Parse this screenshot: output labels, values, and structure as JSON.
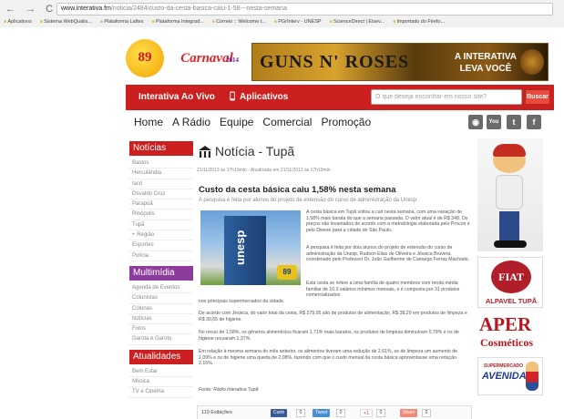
{
  "browser": {
    "nav_buttons": "← → C ⌂",
    "url_host": "www.interativa.fm",
    "url_path": "/noticia/2484/custo-da-cesta-basica-caiu-1-58---nesta-semana",
    "bookmarks": [
      "Aplicativos",
      "Sistema WebQualis...",
      "Plataforma Lattes",
      "Plataforma Integrad...",
      "Correio :: Welcome t...",
      "PGrInterv - UNESP",
      "ScienceDirect | Elsev...",
      "Importado do Firefo..."
    ]
  },
  "banner": {
    "logo_text": "89",
    "carnaval_text": "Carnaval",
    "carnaval_year": "2014",
    "ad_title": "GUNS N' ROSES",
    "ad_slogan_line1": "A INTERATIVA",
    "ad_slogan_line2": "LEVA VOCÊ"
  },
  "red_nav": {
    "live_label": "Interativa Ao Vivo",
    "apps_label": "Aplicativos",
    "search_placeholder": "O que deseja encontrar em nosso site?",
    "search_button": "Buscar"
  },
  "main_menu": [
    "Home",
    "A Rádio",
    "Equipe",
    "Comercial",
    "Promoção"
  ],
  "social_icons": [
    "rss-icon",
    "youtube-icon",
    "twitter-icon",
    "facebook-icon"
  ],
  "social_glyphs": [
    "◉",
    "You",
    "t",
    "f"
  ],
  "sidebar": {
    "noticias": {
      "title": "Notícias",
      "items": [
        "Bastos",
        "Herculândia",
        "Iacri",
        "Osvaldo Cruz",
        "Parapuã",
        "Rinópolis",
        "Tupã",
        "+ Região",
        "Esportes",
        "Polícia"
      ]
    },
    "multimidia": {
      "title": "Multimídia",
      "items": [
        "Agenda de Eventos",
        "Colunistas",
        "Colunas",
        "Notícias",
        "Fotos",
        "Garota e Garoto"
      ]
    },
    "atualidades": {
      "title": "Atualidades",
      "items": [
        "Bem Estar",
        "Música",
        "TV e Cinema"
      ]
    }
  },
  "article": {
    "section_title": "Notícia - Tupã",
    "dateline": "21/11/2013 às 17h19min - Atualizada em 21/11/2013 às 17h19min",
    "headline": "Custo da cesta básica caiu 1,58% nesta semana",
    "subhead": "A pesquisa é feita por alunos do projeto de extensão do curso de administração da Unesp",
    "photo_text": "unesp",
    "photo_badge": "89",
    "paragraphs": {
      "p1": "A cesta básica em Tupã voltou a cair nesta semana, com uma variação de 1,58% mais barata do que a semana passada. O valor atual é de R$ 348. Os preços são levantados de acordo com a metodologia elaborada pelo Procon e pelo Dieese para a cidade de São Paulo.",
      "p2": "A pesquisa é feita por dois alunos do projeto de extensão do curso de administração da Unesp, Rudson Elias de Oliveira e Jéssica Bruvera, coordenado pelo Professor Dr. João Guilherme de Camargo Ferraz Machado.",
      "p3a": "Esta cesta se refere a uma família de quatro membros com renda média familiar de 10,3 salários mínimos mensais, e é composta por 31 produtos comercializados",
      "p3b": "nos principais supermercados da cidade.",
      "p4": "De acordo com Jéssica, do valor total da cesta, R$ 279,05 são de produtos de alimentação, R$ 38,29 em produtos de limpeza e R$ 30,65 de higiene.",
      "p5": "No recuo de 1,58%, os gêneros alimentícios ficaram 1,71% mais baratos, os produtos de limpeza diminuíram 0,79% e os de higiene recuaram 1,37%.",
      "p6": "Em relação à mesma semana do mês anterior, os alimentos tiveram uma redução de 2,61%, os de limpeza um aumento de 1,09% e os de higiene uma queda de 2,08%, fazendo com que o custo mensal da cesta básica apresentasse uma redução 2,16%.",
      "source": "Fonte: Rádio Interativa Tupã"
    },
    "footer": {
      "views": "119 Exibições",
      "fb_label": "Curtir",
      "fb_count": "0",
      "tweet_label": "Tweet",
      "tweet_count": "0",
      "gplus_label": "+1",
      "gplus_count": "0",
      "share_label": "Share",
      "share_count": "0"
    }
  },
  "right_ads": {
    "fiat_badge": "FIAT",
    "fiat_name": "ALPAVEL TUPÃ",
    "aper_big": "APER",
    "aper_small": "Cosméticos",
    "avenida_small": "SUPERMERCADO",
    "avenida_big": "AVENIDA"
  },
  "colors": {
    "accent_red": "#cc1f1f",
    "purple": "#8c3c9c"
  }
}
